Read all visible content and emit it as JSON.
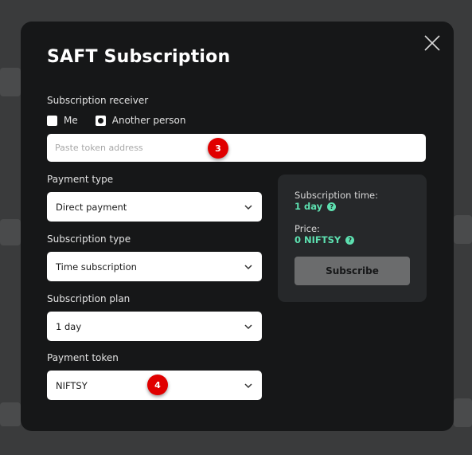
{
  "modal": {
    "title": "SAFT Subscription"
  },
  "receiver": {
    "label": "Subscription receiver",
    "options": [
      "Me",
      "Another person"
    ],
    "selected": "Another person",
    "address_placeholder": "Paste token address"
  },
  "payment_type": {
    "label": "Payment type",
    "value": "Direct payment"
  },
  "subscription_type": {
    "label": "Subscription type",
    "value": "Time subscription"
  },
  "subscription_plan": {
    "label": "Subscription plan",
    "value": "1 day"
  },
  "payment_token": {
    "label": "Payment token",
    "value": "NIFTSY"
  },
  "summary": {
    "time_label": "Subscription time:",
    "time_value": "1 day",
    "price_label": "Price:",
    "price_value": "0 NIFTSY",
    "help_glyph": "?",
    "subscribe_label": "Subscribe"
  },
  "annotations": {
    "step_a": "3",
    "step_b": "4"
  },
  "icons": {
    "close": "close-icon",
    "dropdown": "chevron-down-icon",
    "help": "question-icon"
  },
  "colors": {
    "modal_bg": "#161718",
    "panel_bg": "#26282a",
    "accent": "#5de0b0",
    "badge": "#e00000",
    "button_disabled": "#6b6c6d"
  }
}
